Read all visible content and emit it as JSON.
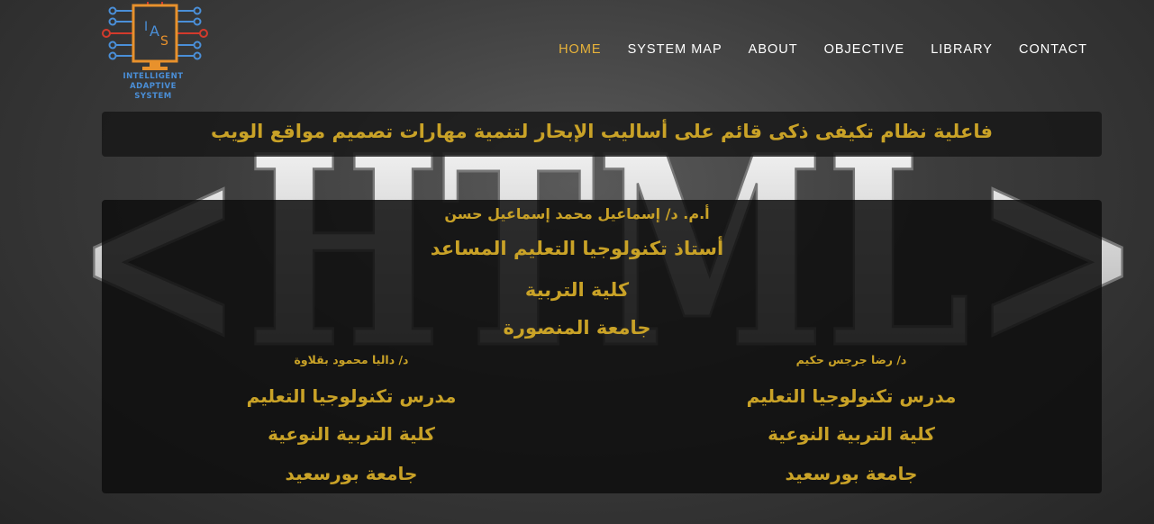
{
  "logo": {
    "mark": "IAS",
    "lines": [
      "INTELLIGENT",
      "ADAPTIVE",
      "SYSTEM"
    ]
  },
  "nav": {
    "items": [
      "HOME",
      "SYSTEM MAP",
      "ABOUT",
      "OBJECTIVE",
      "LIBRARY",
      "CONTACT"
    ],
    "active": "HOME"
  },
  "background_text": "<HTML>",
  "title": "فاعلية نظام تكيفى ذكى قائم على أساليب الإبحار لتنمية مهارات تصميم مواقع الويب",
  "main_supervisor": {
    "name": "أ.م. د/ إسماعيل محمد إسماعيل حسن",
    "position": "أستاذ تكنولوجيا التعليم المساعد",
    "faculty": "كلية التربية",
    "university": "جامعة المنصورة"
  },
  "supervisor_left": {
    "name": "د/ داليا محمود بقلاوة",
    "position": "مدرس تكنولوجيا التعليم",
    "faculty": "كلية التربية النوعية",
    "university": "جامعة بورسعيد"
  },
  "supervisor_right": {
    "name": "د/ رضا جرجس حكيم",
    "position": "مدرس تكنولوجيا التعليم",
    "faculty": "كلية التربية النوعية",
    "university": "جامعة بورسعيد"
  },
  "colors": {
    "accent_gold": "#c9a227",
    "nav_active": "#e8b33a",
    "logo_blue": "#4a8fd8",
    "logo_orange": "#e8912c",
    "logo_red": "#d33a2c"
  }
}
